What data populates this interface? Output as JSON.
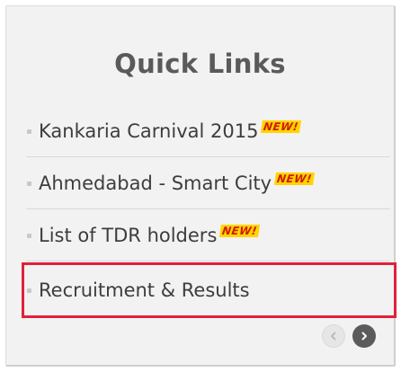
{
  "panel": {
    "title": "Quick Links"
  },
  "links": [
    {
      "label": "Kankaria Carnival 2015",
      "badge": "NEW!"
    },
    {
      "label": "Ahmedabad - Smart City",
      "badge": "NEW!"
    },
    {
      "label": "List of TDR holders",
      "badge": "NEW!"
    },
    {
      "label": "Recruitment & Results",
      "badge": ""
    }
  ],
  "navigation": {
    "prev_icon": "chevron-left-icon",
    "next_icon": "chevron-right-icon"
  },
  "colors": {
    "highlight_border": "#e0223a",
    "badge_background": "#ffd400",
    "badge_text": "#d11a00"
  }
}
